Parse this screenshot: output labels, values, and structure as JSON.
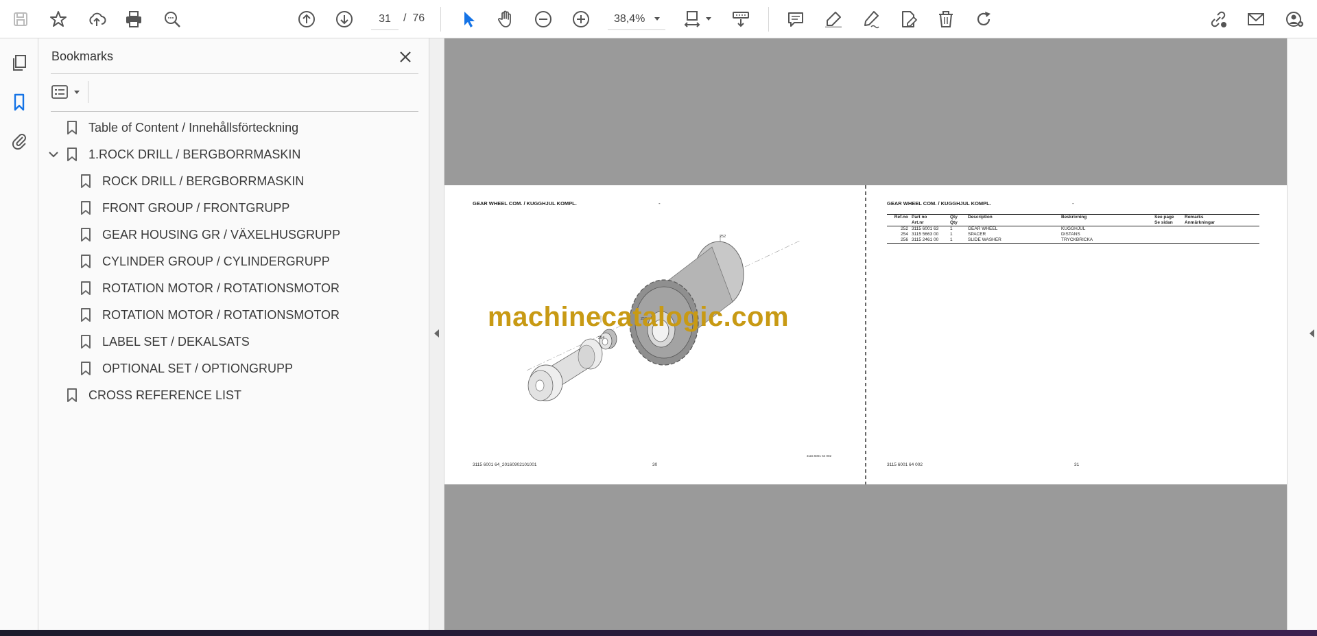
{
  "toolbar": {
    "page_current": "31",
    "page_separator": "/",
    "page_total": "76",
    "zoom": "38,4%"
  },
  "bookmarks": {
    "title": "Bookmarks",
    "items": [
      {
        "label": "Table of Content / Innehållsförteckning",
        "level": 0
      },
      {
        "label": "1.ROCK DRILL / BERGBORRMASKIN",
        "level": 0,
        "expanded": true
      },
      {
        "label": "ROCK DRILL / BERGBORRMASKIN",
        "level": 1
      },
      {
        "label": "FRONT GROUP / FRONTGRUPP",
        "level": 1
      },
      {
        "label": "GEAR HOUSING GR / VÄXELHUSGRUPP",
        "level": 1
      },
      {
        "label": "CYLINDER GROUP / CYLINDERGRUPP",
        "level": 1
      },
      {
        "label": "ROTATION MOTOR / ROTATIONSMOTOR",
        "level": 1
      },
      {
        "label": "ROTATION MOTOR / ROTATIONSMOTOR",
        "level": 1
      },
      {
        "label": "LABEL SET / DEKALSATS",
        "level": 1
      },
      {
        "label": "OPTIONAL SET / OPTIONGRUPP",
        "level": 1
      },
      {
        "label": "CROSS REFERENCE LIST",
        "level": 0
      }
    ]
  },
  "document": {
    "left_page": {
      "heading": "GEAR WHEEL COM. / KUGGHJUL KOMPL.",
      "heading_dash": "-",
      "part_labels": [
        "252",
        "254",
        "256"
      ],
      "drawing_ref": "3115 6001 64 002",
      "footer_left": "3115 6001 64_20160902101001",
      "footer_page": "30"
    },
    "right_page": {
      "heading": "GEAR WHEEL COM. / KUGGHJUL KOMPL.",
      "heading_dash": "-",
      "table": {
        "headers": [
          {
            "line1": "Ref.no",
            "line2": ""
          },
          {
            "line1": "Part no",
            "line2": "Art.nr"
          },
          {
            "line1": "Qty",
            "line2": "Qty"
          },
          {
            "line1": "Description",
            "line2": ""
          },
          {
            "line1": "Beskrivning",
            "line2": ""
          },
          {
            "line1": "See page",
            "line2": "Se sidan"
          },
          {
            "line1": "Remarks",
            "line2": "Anmärkningar"
          }
        ],
        "rows": [
          {
            "ref": "252",
            "part": "3115 6001 63",
            "qty": "1",
            "desc": "GEAR WHEEL",
            "beskr": "KUGGHJUL",
            "page": "",
            "remarks": ""
          },
          {
            "ref": "254",
            "part": "3115 5663 00",
            "qty": "1",
            "desc": "SPACER",
            "beskr": "DISTANS",
            "page": "",
            "remarks": ""
          },
          {
            "ref": "256",
            "part": "3115 2461 00",
            "qty": "1",
            "desc": "SLIDE WASHER",
            "beskr": "TRYCKBRICKA",
            "page": "",
            "remarks": ""
          }
        ]
      },
      "footer_left": "3115 6001 64 002",
      "footer_page": "31"
    },
    "watermark": "machinecatalogic.com"
  },
  "colors": {
    "accent": "#1473e6",
    "doc_background": "#9a9a9a",
    "watermark": "#c89a14"
  }
}
